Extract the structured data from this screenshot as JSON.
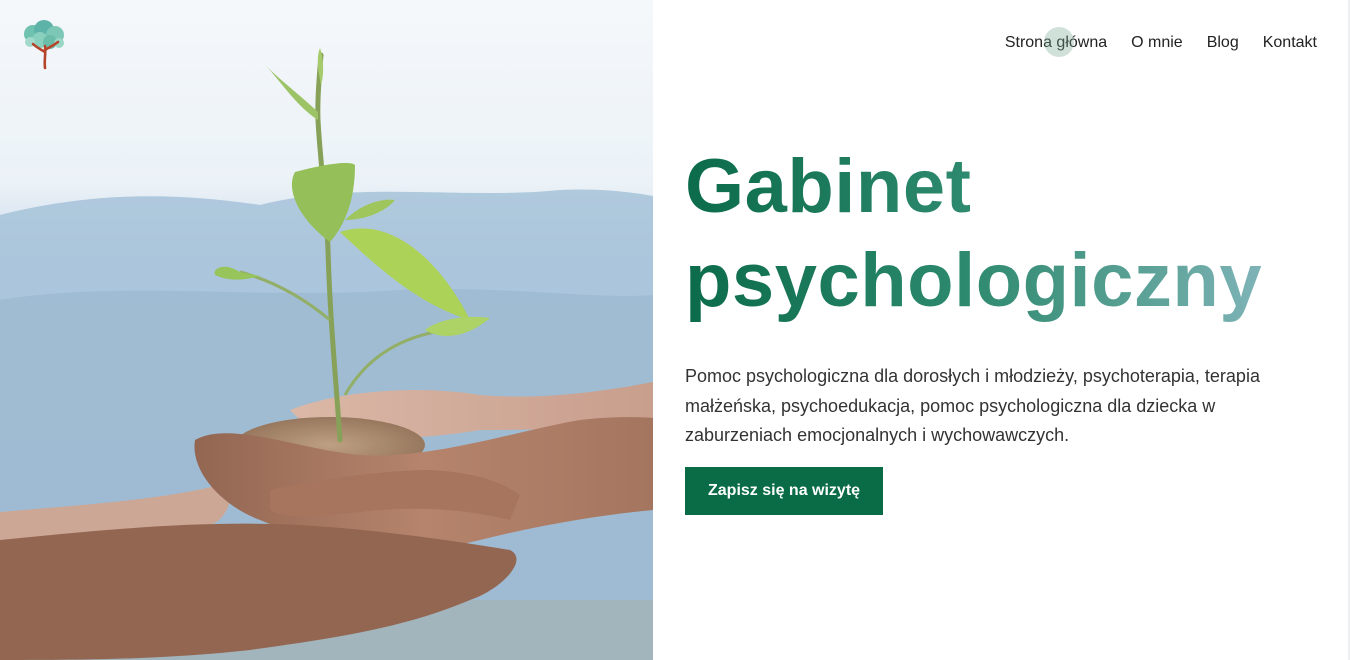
{
  "nav": {
    "items": [
      {
        "label": "Strona główna"
      },
      {
        "label": "O mnie"
      },
      {
        "label": "Blog"
      },
      {
        "label": "Kontakt"
      }
    ]
  },
  "hero": {
    "title_line1": "Gabinet",
    "title_line2": "psychologiczny",
    "description": "Pomoc psychologiczna dla dorosłych i młodzieży, psychoterapia, terapia małżeńska, psychoedukacja, pomoc psychologiczna dla dziecka w zaburzeniach emocjonalnych i wychowawczych.",
    "cta_label": "Zapisz się na wizytę"
  },
  "colors": {
    "brand_green": "#0a6b47",
    "title_gradient_end": "#8fbcc6",
    "text": "#333333"
  },
  "icons": {
    "logo": "tree-logo-icon"
  }
}
